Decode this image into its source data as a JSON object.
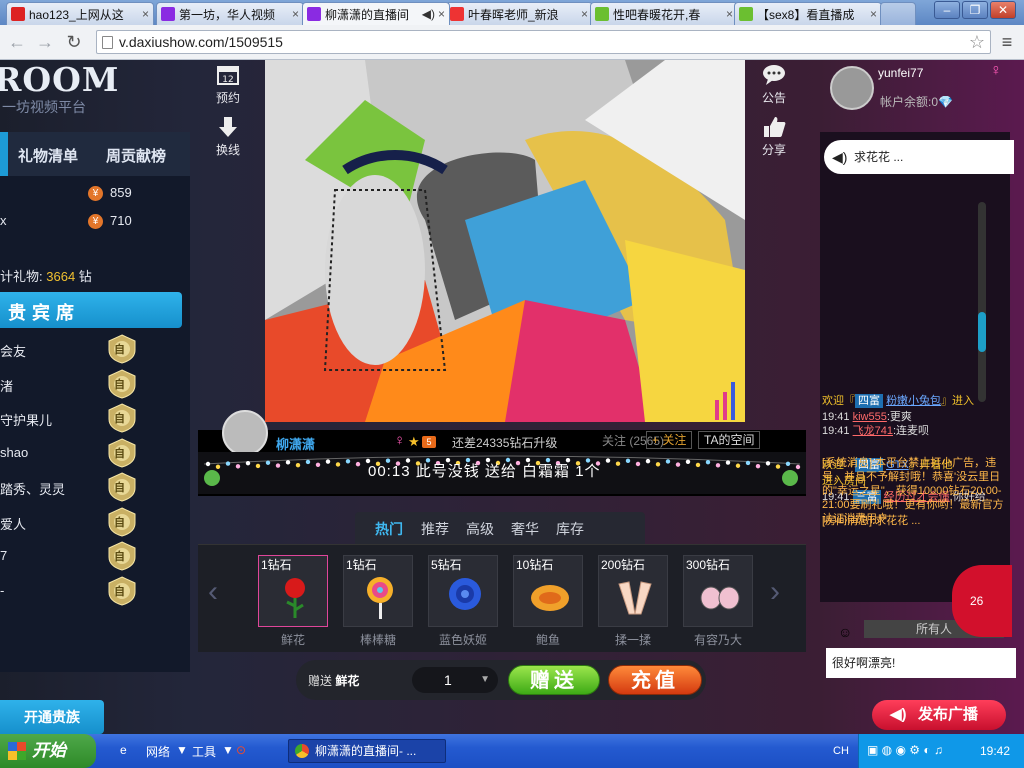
{
  "browser": {
    "tabs": [
      {
        "title": "hao123_上网从这",
        "favicon_color": "#d22"
      },
      {
        "title": "第一坊，华人视频",
        "favicon_color": "#8a2be2"
      },
      {
        "title": "柳潇潇的直播间",
        "favicon_color": "#8a2be2",
        "active": true
      },
      {
        "title": "叶春晖老师_新浪",
        "favicon_color": "#e33"
      },
      {
        "title": "性吧春暖花开,春",
        "favicon_color": "#6bbf30"
      },
      {
        "title": "【sex8】看直播成",
        "favicon_color": "#6bbf30"
      }
    ],
    "url": "v.daxiushow.com/1509515",
    "close_glyph": "×"
  },
  "site": {
    "logo_text": "ROOM",
    "logo_sub": "一坊视频平台"
  },
  "leftpanel": {
    "tabs": [
      "礼物清单",
      "周贡献榜"
    ],
    "ranks": [
      {
        "name": "",
        "value": "859"
      },
      {
        "name": "x",
        "value": "710"
      }
    ],
    "total_label": "计礼物:",
    "total_value": "3664",
    "total_unit": "钻",
    "vip_title": "贵宾席",
    "vips": [
      "会友",
      "渚",
      "守护果儿",
      "shao",
      "踏秀、灵灵",
      "爱人",
      "7",
      "-"
    ],
    "badge_text": "自",
    "join_label": "开通贵族"
  },
  "sideicons": [
    {
      "label": "预约",
      "icon": "calendar-icon"
    },
    {
      "label": "换线",
      "icon": "switch-line-icon"
    },
    {
      "label": "公告",
      "icon": "announcement-icon"
    },
    {
      "label": "分享",
      "icon": "thumbs-up-icon"
    }
  ],
  "host": {
    "name": "柳潇潇",
    "level_text": "还差24335钻石升级",
    "level_num": "5",
    "follow_text": "关注 (2565)",
    "follow_btn": "+ 关注",
    "space_btn": "TA的空间",
    "gift_msg": "00:13  此号没钱 送给 白霜霜   1个"
  },
  "giftpanel": {
    "tabs": [
      "热门",
      "推荐",
      "高级",
      "奢华",
      "库存"
    ],
    "active_tab": "热门",
    "gifts": [
      {
        "price": "1钻石",
        "name": "鲜花",
        "icon": "rose-icon"
      },
      {
        "price": "1钻石",
        "name": "棒棒糖",
        "icon": "lollipop-icon"
      },
      {
        "price": "5钻石",
        "name": "蓝色妖姬",
        "icon": "blue-rose-icon"
      },
      {
        "price": "10钻石",
        "name": "鲍鱼",
        "icon": "abalone-icon"
      },
      {
        "price": "200钻石",
        "name": "揉一揉",
        "icon": "hands-icon"
      },
      {
        "price": "300钻石",
        "name": "有容乃大",
        "icon": "bra-icon"
      }
    ],
    "send_label": "赠送",
    "send_gift": "鲜花",
    "qty": "1",
    "send_btn": "赠送",
    "charge_btn": "充值"
  },
  "rightpanel": {
    "username": "yunfei77",
    "balance": "帐户余额:0",
    "gender": "♀",
    "marquee": "求花花 ...",
    "messages": [
      {
        "time": "",
        "pre": "欢迎『",
        "tag": "四富",
        "user": "粉嫩小兔包",
        "post": "』进入"
      },
      {
        "time": "19:41",
        "user": "kiw555",
        "text": ":更爽"
      },
      {
        "time": "19:41",
        "user": "飞龙741",
        "text": ":连麦呗"
      },
      {
        "time": "",
        "pre": "欢迎『",
        "tag": "四富",
        "user": "GTX",
        "post": "』开着他"
      },
      {
        "time": "",
        "text": "进入房间"
      },
      {
        "time": "19:41",
        "tag": "三富",
        "user": "经历过才会懂",
        "text": ":你好给"
      }
    ],
    "room_msg": "[房间消息]:求花花 ...",
    "sys_msg": "[系统消息]:本平台禁止打小广告，违号，并且不予解封哦！恭喜'没云里日的\"幸运之星\"，获得10000钻石20:00-21:00要刷礼哦！更有你哟！最新官方认证消费用户",
    "all_users": "所有人",
    "chat_text": "很好啊漂亮!",
    "counter": "26",
    "broadcast_btn": "发布广播"
  },
  "taskbar": {
    "start": "开始",
    "items": [
      "网络",
      "工具"
    ],
    "app": "柳潇潇的直播间- ...",
    "lang": "CH",
    "clock": "19:42"
  }
}
